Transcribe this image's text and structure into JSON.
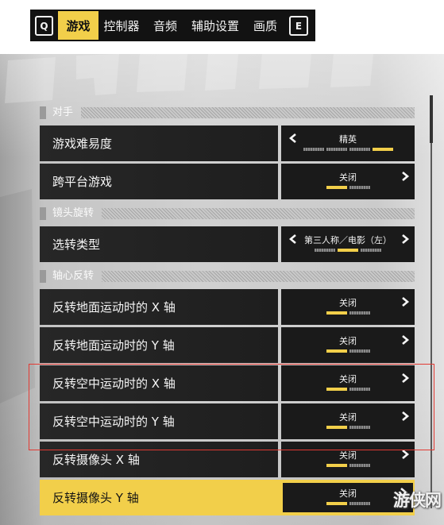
{
  "tabs": {
    "prev_key": "Q",
    "next_key": "E",
    "items": [
      {
        "label": "游戏",
        "selected": true
      },
      {
        "label": "控制器",
        "selected": false
      },
      {
        "label": "音频",
        "selected": false
      },
      {
        "label": "辅助设置",
        "selected": false
      },
      {
        "label": "画质",
        "selected": false
      }
    ]
  },
  "sections": [
    {
      "title": "对手",
      "rows": [
        {
          "label": "游戏难易度",
          "value": "精英",
          "has_prev": true,
          "has_next": false,
          "option_count": 4,
          "selected_option": 3,
          "focused": false
        },
        {
          "label": "跨平台游戏",
          "value": "关闭",
          "has_prev": false,
          "has_next": true,
          "option_count": 2,
          "selected_option": 0,
          "focused": false
        }
      ]
    },
    {
      "title": "镜头旋转",
      "rows": [
        {
          "label": "选转类型",
          "value": "第三人称／电影（左）",
          "has_prev": true,
          "has_next": true,
          "option_count": 3,
          "selected_option": 1,
          "focused": false
        }
      ]
    },
    {
      "title": "轴心反转",
      "rows": [
        {
          "label": "反转地面运动时的 X 轴",
          "value": "关闭",
          "has_prev": false,
          "has_next": true,
          "option_count": 2,
          "selected_option": 0,
          "focused": false
        },
        {
          "label": "反转地面运动时的 Y 轴",
          "value": "关闭",
          "has_prev": false,
          "has_next": true,
          "option_count": 2,
          "selected_option": 0,
          "focused": false
        },
        {
          "label": "反转空中运动时的 X 轴",
          "value": "关闭",
          "has_prev": false,
          "has_next": true,
          "option_count": 2,
          "selected_option": 0,
          "focused": false
        },
        {
          "label": "反转空中运动时的 Y 轴",
          "value": "关闭",
          "has_prev": false,
          "has_next": true,
          "option_count": 2,
          "selected_option": 0,
          "focused": false
        },
        {
          "label": "反转摄像头 X 轴",
          "value": "关闭",
          "has_prev": false,
          "has_next": true,
          "option_count": 2,
          "selected_option": 0,
          "focused": false
        },
        {
          "label": "反转摄像头 Y 轴",
          "value": "关闭",
          "has_prev": false,
          "has_next": true,
          "option_count": 2,
          "selected_option": 0,
          "focused": true
        }
      ]
    }
  ],
  "icons": {
    "prev": "chevron-left-icon",
    "next": "chevron-right-icon",
    "key_prev": "q-key-icon",
    "key_next": "e-key-icon"
  },
  "colors": {
    "accent": "#f2cf4a",
    "row_bg": "#222222",
    "value_bg": "#1a1a1a",
    "tab_bar_bg": "#121212",
    "highlight_outline": "#e23a33"
  },
  "watermark": "游侠网"
}
